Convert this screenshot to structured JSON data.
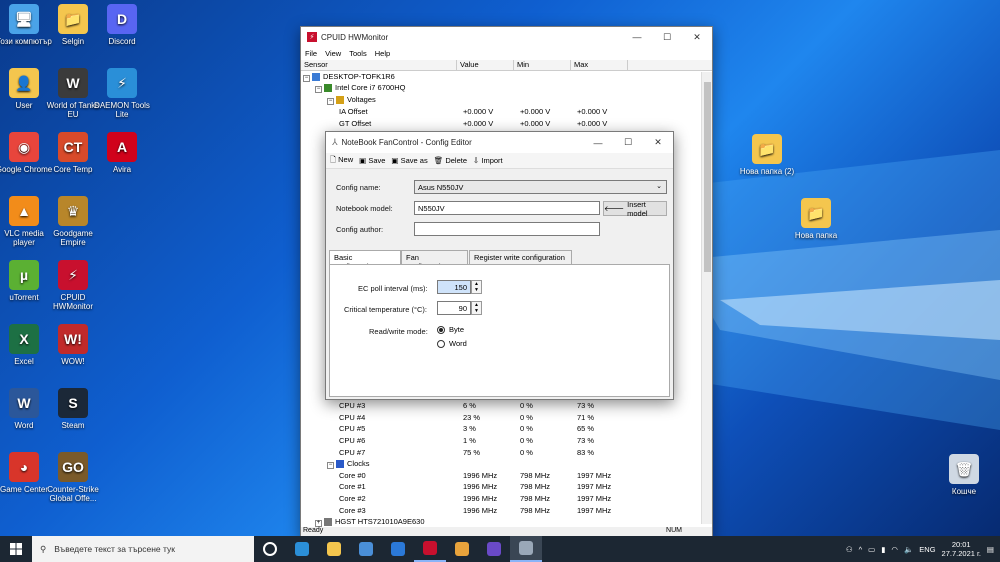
{
  "desktop_icons": [
    {
      "label": "Този компютър",
      "color": "#4aa3e8",
      "glyph": "🖥"
    },
    {
      "label": "Selgin",
      "color": "#f4c64e",
      "glyph": "📁"
    },
    {
      "label": "Discord",
      "color": "#5865f2",
      "glyph": "D"
    },
    {
      "label": "User",
      "color": "#f4c64e",
      "glyph": "👤"
    },
    {
      "label": "World of Tanks EU",
      "color": "#3b3b3b",
      "glyph": "W"
    },
    {
      "label": "DAEMON Tools Lite",
      "color": "#2a8fd8",
      "glyph": "⚡"
    },
    {
      "label": "Google Chrome",
      "color": "#e8453c",
      "glyph": "◉"
    },
    {
      "label": "Core Temp",
      "color": "#d84a2a",
      "glyph": "CT"
    },
    {
      "label": "Avira",
      "color": "#d0021b",
      "glyph": "A"
    },
    {
      "label": "VLC media player",
      "color": "#f28c1a",
      "glyph": "▲"
    },
    {
      "label": "Goodgame Empire",
      "color": "#b8862a",
      "glyph": "♛"
    },
    {
      "label": "uTorrent",
      "color": "#5bb033",
      "glyph": "µ"
    },
    {
      "label": "CPUID HWMonitor",
      "color": "#c8102e",
      "glyph": "⚡"
    },
    {
      "label": "Excel",
      "color": "#1d7044",
      "glyph": "X"
    },
    {
      "label": "WOW!",
      "color": "#c12a2a",
      "glyph": "W!"
    },
    {
      "label": "Word",
      "color": "#2b579a",
      "glyph": "W"
    },
    {
      "label": "Steam",
      "color": "#1b2838",
      "glyph": "S"
    },
    {
      "label": "Game Center",
      "color": "#d8352a",
      "glyph": "◕"
    },
    {
      "label": "Counter-Strike Global Offe...",
      "color": "#7a5a2a",
      "glyph": "GO"
    }
  ],
  "right_icons": [
    {
      "label": "Нова папка (2)",
      "color": "#f4c64e",
      "glyph": "📁"
    },
    {
      "label": "Нова папка",
      "color": "#f4c64e",
      "glyph": "📁"
    },
    {
      "label": "Кошче",
      "color": "#cfd8e3",
      "glyph": "🗑"
    }
  ],
  "hwmonitor": {
    "title": "CPUID HWMonitor",
    "menu": [
      "File",
      "View",
      "Tools",
      "Help"
    ],
    "columns": [
      "Sensor",
      "Value",
      "Min",
      "Max"
    ],
    "rows": [
      {
        "indent": 0,
        "exp": "−",
        "name": "DESKTOP-TOFK1R6",
        "v": "",
        "min": "",
        "max": "",
        "icon": "pc"
      },
      {
        "indent": 1,
        "exp": "−",
        "name": "Intel Core i7 6700HQ",
        "v": "",
        "min": "",
        "max": "",
        "icon": "chip"
      },
      {
        "indent": 2,
        "exp": "−",
        "name": "Voltages",
        "v": "",
        "min": "",
        "max": "",
        "icon": "volt"
      },
      {
        "indent": 3,
        "exp": "",
        "name": "IA Offset",
        "v": "+0.000 V",
        "min": "+0.000 V",
        "max": "+0.000 V",
        "icon": ""
      },
      {
        "indent": 3,
        "exp": "",
        "name": "GT Offset",
        "v": "+0.000 V",
        "min": "+0.000 V",
        "max": "+0.000 V",
        "icon": ""
      }
    ],
    "rows_bottom": [
      {
        "indent": 3,
        "exp": "",
        "name": "CPU #3",
        "v": "6 %",
        "min": "0 %",
        "max": "73 %",
        "icon": ""
      },
      {
        "indent": 3,
        "exp": "",
        "name": "CPU #4",
        "v": "23 %",
        "min": "0 %",
        "max": "71 %",
        "icon": ""
      },
      {
        "indent": 3,
        "exp": "",
        "name": "CPU #5",
        "v": "3 %",
        "min": "0 %",
        "max": "65 %",
        "icon": ""
      },
      {
        "indent": 3,
        "exp": "",
        "name": "CPU #6",
        "v": "1 %",
        "min": "0 %",
        "max": "73 %",
        "icon": ""
      },
      {
        "indent": 3,
        "exp": "",
        "name": "CPU #7",
        "v": "75 %",
        "min": "0 %",
        "max": "83 %",
        "icon": ""
      },
      {
        "indent": 2,
        "exp": "−",
        "name": "Clocks",
        "v": "",
        "min": "",
        "max": "",
        "icon": "clock"
      },
      {
        "indent": 3,
        "exp": "",
        "name": "Core #0",
        "v": "1996 MHz",
        "min": "798 MHz",
        "max": "1997 MHz",
        "icon": ""
      },
      {
        "indent": 3,
        "exp": "",
        "name": "Core #1",
        "v": "1996 MHz",
        "min": "798 MHz",
        "max": "1997 MHz",
        "icon": ""
      },
      {
        "indent": 3,
        "exp": "",
        "name": "Core #2",
        "v": "1996 MHz",
        "min": "798 MHz",
        "max": "1997 MHz",
        "icon": ""
      },
      {
        "indent": 3,
        "exp": "",
        "name": "Core #3",
        "v": "1996 MHz",
        "min": "798 MHz",
        "max": "1997 MHz",
        "icon": ""
      },
      {
        "indent": 1,
        "exp": "+",
        "name": "HGST HTS721010A9E630",
        "v": "",
        "min": "",
        "max": "",
        "icon": "disk"
      }
    ],
    "status": "Ready",
    "num": "NUM"
  },
  "config": {
    "title": "NoteBook FanControl - Config Editor",
    "toolbar": [
      "New",
      "Save",
      "Save as",
      "Delete",
      "Import"
    ],
    "config_name_label": "Config name:",
    "config_name_value": "Asus N550JV",
    "notebook_model_label": "Notebook model:",
    "notebook_model_value": "N550JV",
    "insert_model": "Insert model",
    "config_author_label": "Config author:",
    "config_author_value": "",
    "tabs": [
      "Basic configuration",
      "Fan configuration",
      "Register write configuration"
    ],
    "ec_poll_label": "EC poll interval (ms):",
    "ec_poll_value": "150",
    "critical_label": "Critical temperature (°C):",
    "critical_value": "90",
    "rw_label": "Read/write mode:",
    "rw_options": [
      "Byte",
      "Word"
    ]
  },
  "taskbar": {
    "search_placeholder": "Въведете текст за търсене тук",
    "apps": [
      {
        "name": "task-view",
        "color": "#ffffff"
      },
      {
        "name": "edge",
        "color": "#2b8fd8"
      },
      {
        "name": "file-explorer",
        "color": "#f4c64e"
      },
      {
        "name": "store",
        "color": "#4a8fd8"
      },
      {
        "name": "mail",
        "color": "#2b79d8"
      },
      {
        "name": "hwmonitor",
        "color": "#c8102e"
      },
      {
        "name": "chrome",
        "color": "#e8a33c"
      },
      {
        "name": "app",
        "color": "#6a4ac8"
      },
      {
        "name": "fancontrol",
        "color": "#9aa8b8"
      }
    ],
    "lang": "ENG",
    "time": "20:01",
    "date": "27.7.2021 г."
  }
}
